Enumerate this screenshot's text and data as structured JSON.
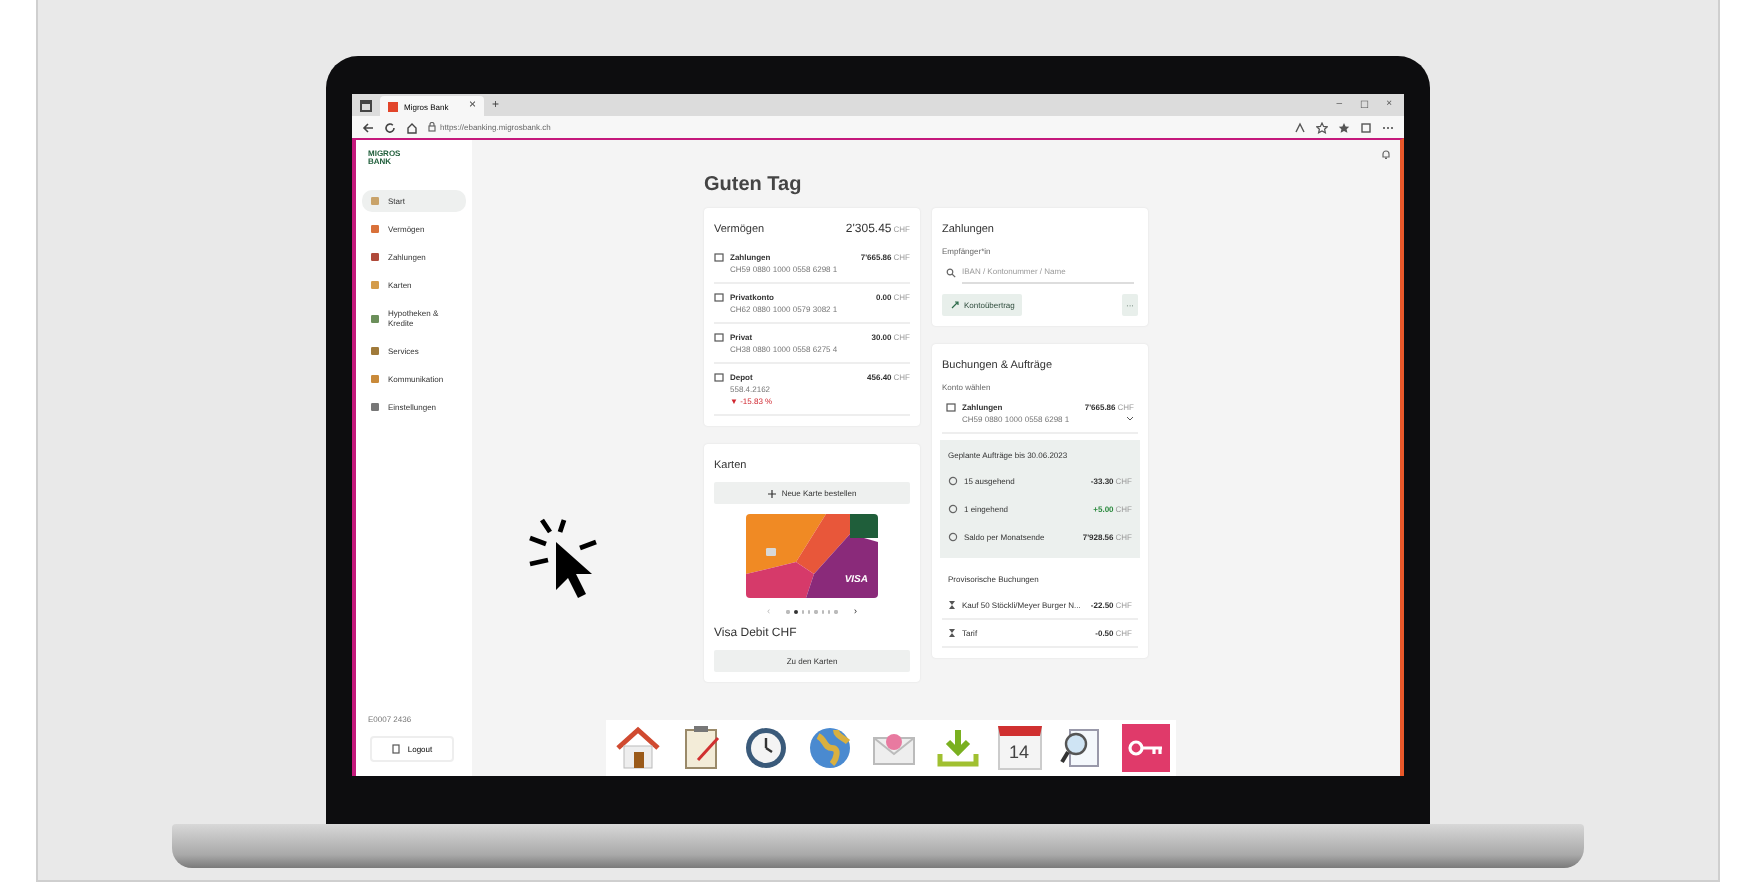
{
  "browser": {
    "tab_title": "Migros Bank",
    "tab_close": "×",
    "new_tab": "+",
    "url": "https://ebanking.migrosbank.ch",
    "window_controls": [
      "–",
      "☐",
      "×"
    ]
  },
  "sidebar": {
    "logo": "MIGROS BANK",
    "items": [
      {
        "label": "Start",
        "selected": true
      },
      {
        "label": "Vermögen",
        "selected": false
      },
      {
        "label": "Zahlungen",
        "selected": false
      },
      {
        "label": "Karten",
        "selected": false
      },
      {
        "label": "Hypotheken & Kredite",
        "selected": false
      },
      {
        "label": "Services",
        "selected": false
      },
      {
        "label": "Kommunikation",
        "selected": false
      },
      {
        "label": "Einstellungen",
        "selected": false
      }
    ],
    "user_id": "E0007 2436",
    "logout": "Logout"
  },
  "greeting": "Guten Tag",
  "assets": {
    "title": "Vermögen",
    "total": "2'305.45",
    "currency": "CHF",
    "accounts": [
      {
        "name": "Zahlungen",
        "number": "CH59 0880 1000 0558 6298 1",
        "amount": "7'665.86",
        "currency": "CHF"
      },
      {
        "name": "Privatkonto",
        "number": "CH62 0880 1000 0579 3082 1",
        "amount": "0.00",
        "currency": "CHF"
      },
      {
        "name": "Privat",
        "number": "CH38 0880 1000 0558 6275 4",
        "amount": "30.00",
        "currency": "CHF"
      },
      {
        "name": "Depot",
        "number": "558.4.2162",
        "amount": "456.40",
        "currency": "CHF",
        "change": "▼ -15.83 %"
      }
    ]
  },
  "cards": {
    "title": "Karten",
    "order_button": "Neue Karte bestellen",
    "card_brand": "VISA",
    "pager": [
      {
        "selected": false
      },
      {
        "selected": true
      },
      {
        "selected": false
      },
      {
        "selected": false
      },
      {
        "selected": false
      },
      {
        "selected": false
      },
      {
        "selected": false
      },
      {
        "selected": false
      }
    ],
    "prev": "‹",
    "next": "›",
    "card_name": "Visa Debit CHF",
    "link_button": "Zu den Karten"
  },
  "payments": {
    "title": "Zahlungen",
    "recipient_label": "Empfänger*in",
    "search": {
      "placeholder": "IBAN / Kontonummer / Name"
    },
    "transfer_button": "Kontoübertrag",
    "more_button": "···"
  },
  "bookings": {
    "title": "Buchungen & Aufträge",
    "account_label": "Konto wählen",
    "account": {
      "name": "Zahlungen",
      "number": "CH59 0880 1000 0558 6298 1",
      "amount": "7'665.86",
      "currency": "CHF"
    },
    "planned": {
      "title": "Geplante Aufträge bis 30.06.2023",
      "rows": [
        {
          "label": "15 ausgehend",
          "amount": "-33.30",
          "currency": "CHF",
          "kind": "negative"
        },
        {
          "label": "1 eingehend",
          "amount": "+5.00",
          "currency": "CHF",
          "kind": "positive"
        },
        {
          "label": "Saldo per Monatsende",
          "amount": "7'928.56",
          "currency": "CHF",
          "kind": "neutral"
        }
      ]
    },
    "provisional": {
      "title": "Provisorische Buchungen",
      "rows": [
        {
          "label": "Kauf 50 Stöckli/Meyer Burger N...",
          "amount": "-22.50",
          "currency": "CHF"
        },
        {
          "label": "Tarif",
          "amount": "-0.50",
          "currency": "CHF"
        }
      ]
    }
  },
  "dock": {
    "calendar_day": "14"
  }
}
